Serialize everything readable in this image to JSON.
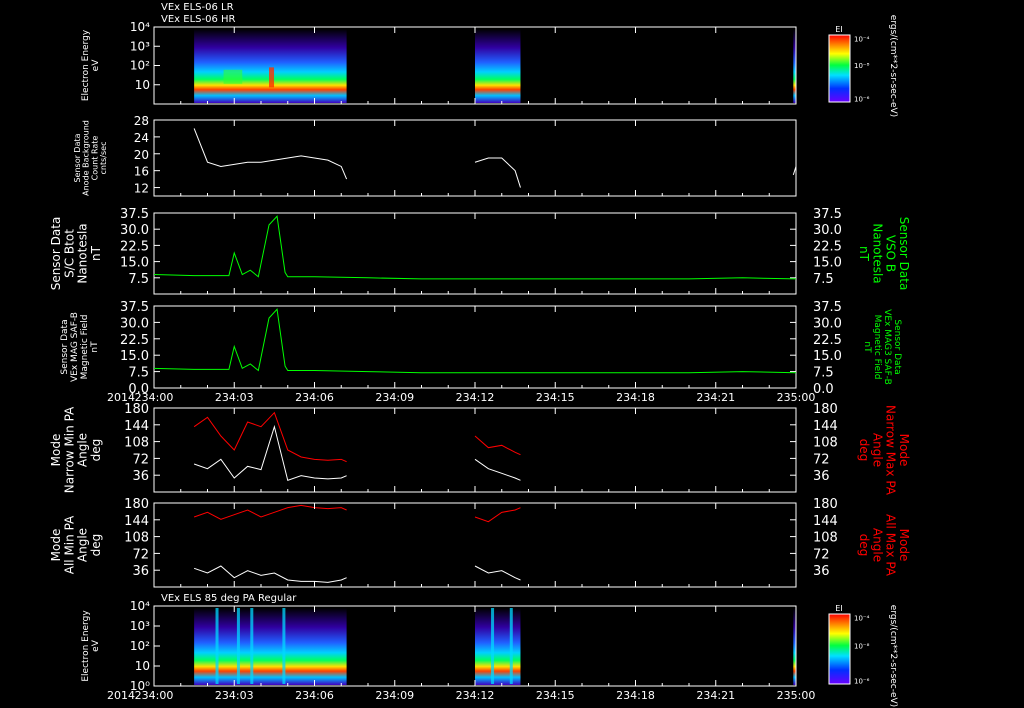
{
  "titles": {
    "top_line1": "VEx ELS-06 LR",
    "top_line2": "VEx ELS-06 HR",
    "bottom": "VEx ELS 85 deg PA Regular"
  },
  "time_axis": {
    "year": "2014",
    "ticks": [
      "234:00",
      "234:03",
      "234:06",
      "234:09",
      "234:12",
      "234:15",
      "234:18",
      "234:21",
      "235:00"
    ]
  },
  "colors": {
    "white": "#ffffff",
    "green": "#00ff00",
    "red": "#ff0000",
    "frame": "#ffffff"
  },
  "chart_data": [
    {
      "type": "heatmap",
      "name": "els_lr_hr",
      "ylabel_lines": [
        "Electron Energy",
        "eV"
      ],
      "yscale": "log",
      "ylim": [
        1,
        10000
      ],
      "ytick_labels": [
        "10⁴",
        "10³",
        "10²",
        "10"
      ],
      "colorbar": {
        "label": "EI",
        "unit": "ergs/(cm**2-sr-sec-eV)",
        "ticks": [
          "10⁻⁴",
          "10⁻⁸",
          "10⁻⁶"
        ]
      },
      "data_intervals": [
        [
          "234:01.5",
          "234:07.2"
        ],
        [
          "234:12.0",
          "234:13.7"
        ],
        [
          "234:23.9",
          "235:00"
        ]
      ]
    },
    {
      "type": "line",
      "name": "anode_background",
      "ylabel_lines": [
        "Sensor Data",
        "Anode Background",
        "Count Rate",
        "cnts/sec"
      ],
      "ylim": [
        10,
        28
      ],
      "yticks": [
        12,
        16,
        20,
        24,
        28
      ],
      "color": "#ffffff",
      "x": [
        "234:01.5",
        "234:02.0",
        "234:02.5",
        "234:03.0",
        "234:03.5",
        "234:04.0",
        "234:04.5",
        "234:05.0",
        "234:05.5",
        "234:06.0",
        "234:06.5",
        "234:07.0",
        "234:07.2",
        "234:12.0",
        "234:12.5",
        "234:13.0",
        "234:13.5",
        "234:13.7",
        "234:23.9",
        "235:00"
      ],
      "y": [
        26,
        18,
        17,
        17.5,
        18,
        18,
        18.5,
        19,
        19.5,
        19,
        18.5,
        17,
        14,
        18,
        19,
        19,
        16,
        12,
        15,
        17
      ]
    },
    {
      "type": "line",
      "name": "sc_btot",
      "ylabel_lines": [
        "Sensor Data",
        "S/C Btot",
        "Nanotesla",
        "nT"
      ],
      "right_label_lines": [
        "Sensor Data",
        "VSO B",
        "Nanotesla",
        "nT"
      ],
      "ylim": [
        0,
        37.5
      ],
      "yticks": [
        7.5,
        15.0,
        22.5,
        30.0,
        37.5
      ],
      "color": "#00ff00",
      "x": [
        "234:00",
        "234:01.5",
        "234:02.8",
        "234:03.0",
        "234:03.3",
        "234:03.6",
        "234:03.9",
        "234:04.1",
        "234:04.3",
        "234:04.6",
        "234:04.9",
        "234:05.0",
        "234:06.0",
        "234:08.0",
        "234:10.0",
        "234:12.0",
        "234:14.0",
        "234:16.0",
        "234:18.0",
        "234:20.0",
        "234:22.0",
        "235:00"
      ],
      "y": [
        9,
        8.5,
        8.5,
        19,
        9,
        11,
        8,
        20,
        32,
        36,
        10,
        8,
        8,
        7.5,
        7,
        7,
        7,
        7,
        7,
        7,
        7.5,
        7
      ]
    },
    {
      "type": "line",
      "name": "mag_saf_b",
      "ylabel_lines": [
        "Sensor Data",
        "VEx MAG SAF-B",
        "Magnetic Field",
        "nT"
      ],
      "right_label_lines": [
        "Sensor Data",
        "VEx MAG3 SAF-B",
        "Magnetic Field",
        "nT"
      ],
      "ylim": [
        0,
        37.5
      ],
      "yticks": [
        0.0,
        7.5,
        15.0,
        22.5,
        30.0,
        37.5
      ],
      "color": "#00ff00",
      "x": [
        "234:00",
        "234:01.5",
        "234:02.8",
        "234:03.0",
        "234:03.3",
        "234:03.6",
        "234:03.9",
        "234:04.1",
        "234:04.3",
        "234:04.6",
        "234:04.9",
        "234:05.0",
        "234:06.0",
        "234:08.0",
        "234:10.0",
        "234:12.0",
        "234:14.0",
        "234:16.0",
        "234:18.0",
        "234:20.0",
        "234:22.0",
        "235:00"
      ],
      "y": [
        9,
        8.5,
        8.5,
        19,
        9,
        11,
        8,
        20,
        32,
        36,
        10,
        8,
        8,
        7.5,
        7,
        7,
        7,
        7,
        7,
        7,
        7.5,
        7
      ]
    },
    {
      "type": "line",
      "name": "narrow_pa",
      "ylabel_lines": [
        "Mode",
        "Narrow Min PA",
        "Angle",
        "deg"
      ],
      "right_label_lines": [
        "Mode",
        "Narrow Max PA",
        "Angle",
        "deg"
      ],
      "ylim": [
        0,
        180
      ],
      "yticks": [
        36,
        72,
        108,
        144,
        180
      ],
      "series": [
        {
          "color": "#ffffff",
          "x": [
            "234:01.5",
            "234:02.0",
            "234:02.5",
            "234:03.0",
            "234:03.5",
            "234:04.0",
            "234:04.5",
            "234:05.0",
            "234:05.5",
            "234:06.0",
            "234:06.5",
            "234:07.0",
            "234:07.2"
          ],
          "y": [
            60,
            50,
            70,
            30,
            55,
            48,
            140,
            25,
            35,
            30,
            28,
            30,
            35
          ]
        },
        {
          "color": "#ff0000",
          "x": [
            "234:01.5",
            "234:02.0",
            "234:02.5",
            "234:03.0",
            "234:03.5",
            "234:04.0",
            "234:04.5",
            "234:05.0",
            "234:05.5",
            "234:06.0",
            "234:06.5",
            "234:07.0",
            "234:07.2"
          ],
          "y": [
            140,
            160,
            120,
            90,
            150,
            140,
            170,
            90,
            75,
            70,
            68,
            70,
            65
          ]
        },
        {
          "color": "#ffffff",
          "x": [
            "234:12.0",
            "234:12.5",
            "234:13.0",
            "234:13.5",
            "234:13.7"
          ],
          "y": [
            70,
            50,
            40,
            30,
            25
          ]
        },
        {
          "color": "#ff0000",
          "x": [
            "234:12.0",
            "234:12.5",
            "234:13.0",
            "234:13.5",
            "234:13.7"
          ],
          "y": [
            120,
            95,
            100,
            85,
            80
          ]
        }
      ]
    },
    {
      "type": "line",
      "name": "all_pa",
      "ylabel_lines": [
        "Mode",
        "All Min PA",
        "Angle",
        "deg"
      ],
      "right_label_lines": [
        "Mode",
        "All Max PA",
        "Angle",
        "deg"
      ],
      "ylim": [
        0,
        180
      ],
      "yticks": [
        36,
        72,
        108,
        144,
        180
      ],
      "series": [
        {
          "color": "#ffffff",
          "x": [
            "234:01.5",
            "234:02.0",
            "234:02.5",
            "234:03.0",
            "234:03.5",
            "234:04.0",
            "234:04.5",
            "234:05.0",
            "234:05.5",
            "234:06.0",
            "234:06.5",
            "234:07.0",
            "234:07.2"
          ],
          "y": [
            40,
            30,
            45,
            20,
            35,
            25,
            30,
            15,
            12,
            12,
            10,
            15,
            20
          ]
        },
        {
          "color": "#ff0000",
          "x": [
            "234:01.5",
            "234:02.0",
            "234:02.5",
            "234:03.0",
            "234:03.5",
            "234:04.0",
            "234:04.5",
            "234:05.0",
            "234:05.5",
            "234:06.0",
            "234:06.5",
            "234:07.0",
            "234:07.2"
          ],
          "y": [
            150,
            160,
            145,
            155,
            165,
            150,
            160,
            170,
            175,
            170,
            168,
            170,
            165
          ]
        },
        {
          "color": "#ffffff",
          "x": [
            "234:12.0",
            "234:12.5",
            "234:13.0",
            "234:13.5",
            "234:13.7"
          ],
          "y": [
            45,
            30,
            35,
            20,
            15
          ]
        },
        {
          "color": "#ff0000",
          "x": [
            "234:12.0",
            "234:12.5",
            "234:13.0",
            "234:13.5",
            "234:13.7"
          ],
          "y": [
            150,
            140,
            160,
            165,
            170
          ]
        }
      ]
    },
    {
      "type": "heatmap",
      "name": "els_85deg",
      "ylabel_lines": [
        "Electron Energy",
        "eV"
      ],
      "yscale": "log",
      "ylim": [
        1,
        10000
      ],
      "ytick_labels": [
        "10⁴",
        "10³",
        "10²",
        "10",
        "10⁰"
      ],
      "colorbar": {
        "label": "EI",
        "unit": "ergs/(cm**2-sr-sec-eV)",
        "ticks": [
          "10⁻⁴",
          "10⁻⁸",
          "10⁻⁶"
        ]
      },
      "data_intervals": [
        [
          "234:01.5",
          "234:07.2"
        ],
        [
          "234:12.0",
          "234:13.7"
        ],
        [
          "234:23.9",
          "235:00"
        ]
      ]
    }
  ]
}
